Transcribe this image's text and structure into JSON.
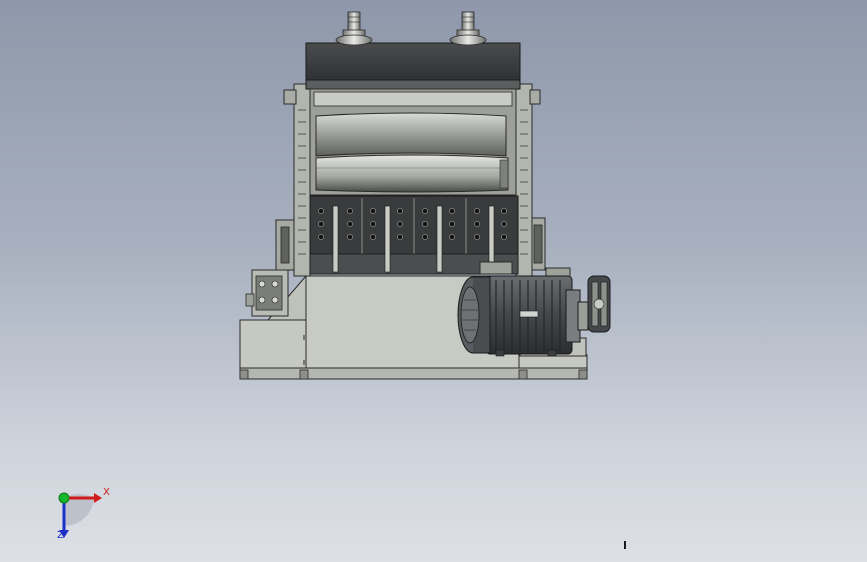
{
  "viewport": {
    "background_top": "#8e98aa",
    "background_bottom": "#dde0e5"
  },
  "model": {
    "kind": "cad-assembly-front-view",
    "colors": {
      "frame": "#c4c7c1",
      "frame_dark": "#8d908a",
      "outline": "#2a2a2a",
      "shell_dark": "#3c3d3e",
      "motor_body": "#55585b",
      "motor_fins": "#2e3033"
    }
  },
  "triad": {
    "x_label": "X",
    "z_label": "Z",
    "x_color": "#d01c1c",
    "y_color": "#16b82a",
    "z_color": "#1c2fc8"
  }
}
